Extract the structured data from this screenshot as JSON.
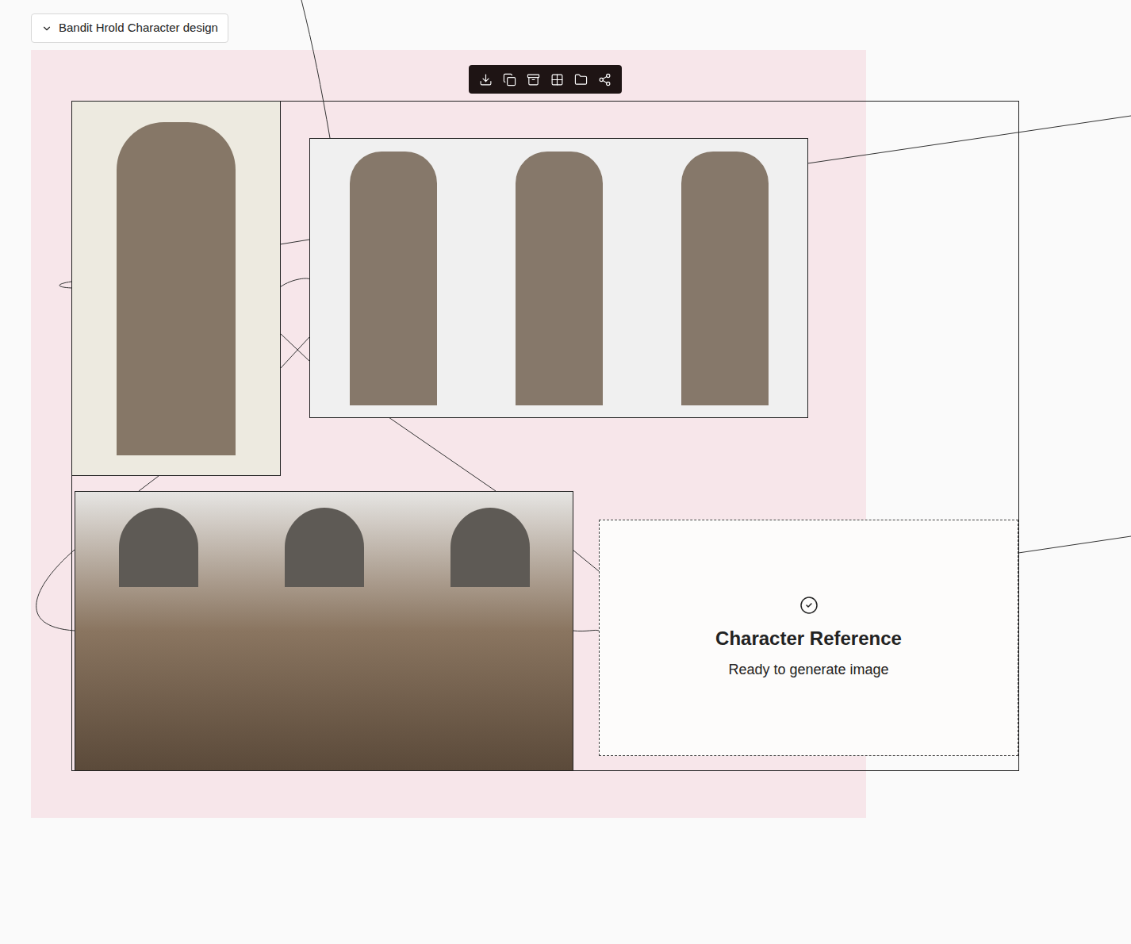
{
  "group": {
    "title": "Bandit Hrold Character design",
    "expanded": true,
    "selected": true
  },
  "images": [
    {
      "kind": "illustration"
    },
    {
      "kind": "turnaround"
    },
    {
      "kind": "headshots"
    }
  ],
  "card": {
    "title": "Character Reference",
    "status": "Ready to generate image"
  }
}
